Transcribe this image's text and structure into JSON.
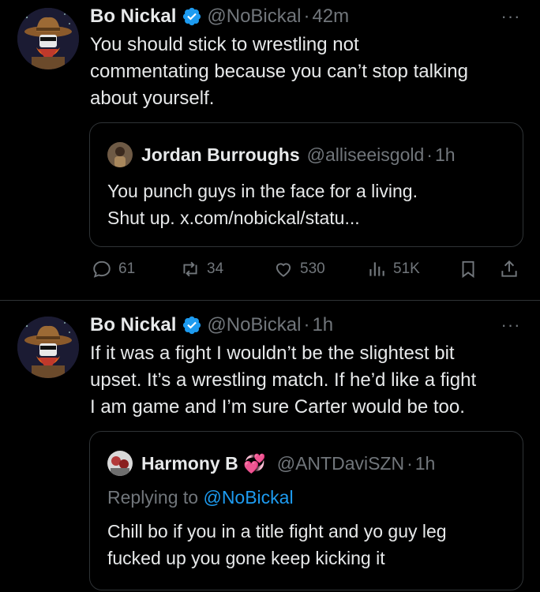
{
  "tweets": [
    {
      "author_name": "Bo Nickal",
      "handle": "@NoBickal",
      "separator": "·",
      "time": "42m",
      "more": "···",
      "text_lines": [
        "You should stick to wrestling not",
        "commentating because you can’t stop talking",
        "about yourself."
      ],
      "quote": {
        "author_name": "Jordan Burroughs",
        "handle": "@alliseeisgold",
        "separator": "·",
        "time": "1h",
        "text_lines": [
          "You punch guys in the face for a living.",
          "Shut up. x.com/nobickal/statu..."
        ]
      },
      "actions": {
        "replies": "61",
        "reposts": "34",
        "likes": "530",
        "views": "51K"
      }
    },
    {
      "author_name": "Bo Nickal",
      "handle": "@NoBickal",
      "separator": "·",
      "time": "1h",
      "more": "···",
      "text_lines": [
        "If it was a fight I wouldn’t be the slightest bit",
        "upset. It’s a wrestling match. If he’d like a fight",
        "I am game and I’m sure Carter would be too."
      ],
      "quote": {
        "author_name": "Harmony B 💞",
        "handle": "@ANTDaviSZN",
        "separator": "·",
        "time": "1h",
        "replying_prefix": "Replying to ",
        "replying_handle": "@NoBickal",
        "text_lines": [
          "Chill bo if you in a title fight and yo guy leg",
          "fucked up you gone keep kicking it"
        ]
      }
    }
  ],
  "colors": {
    "background": "#000000",
    "text": "#e7e9ea",
    "secondary": "#71767b",
    "accent": "#1d9bf0",
    "border": "#2f3336"
  }
}
